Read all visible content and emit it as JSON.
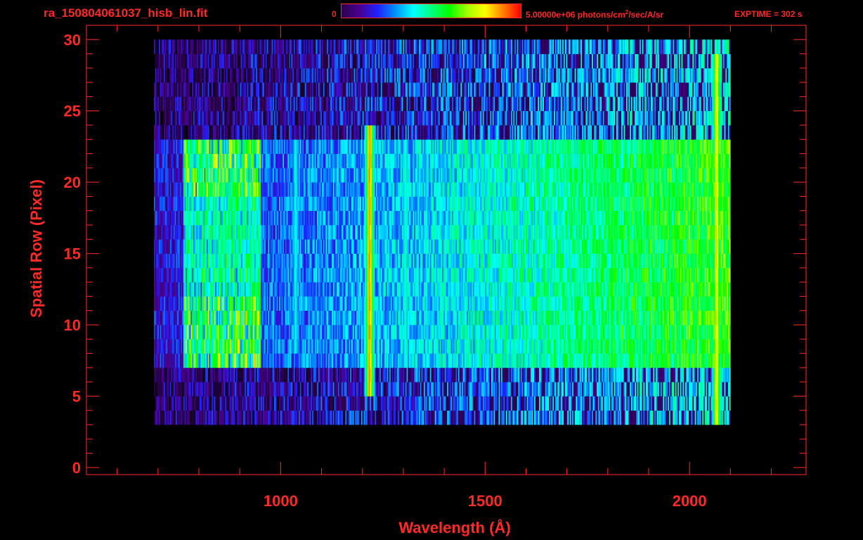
{
  "header": {
    "file_title": "ra_150804061037_hisb_lin.fit",
    "colorbar_min": "0",
    "colorbar_max_prefix": "5.00000e+06 photons/cm",
    "colorbar_max_exp": "2",
    "colorbar_max_suffix": "/sec/A/sr",
    "exptime": "EXPTIME = 302 s"
  },
  "colors": {
    "axis": "#ff2a2a",
    "background": "#000000",
    "colormap": [
      "#000000",
      "#2a0050",
      "#4a0090",
      "#2020ff",
      "#0090ff",
      "#00ffff",
      "#00ff80",
      "#00ff00",
      "#a0ff00",
      "#ffff00",
      "#ff8000",
      "#ff0000"
    ]
  },
  "chart_data": {
    "type": "heatmap",
    "title": "",
    "xlabel": "Wavelength (Å)",
    "ylabel": "Spatial Row (Pixel)",
    "xlim": [
      525,
      2285
    ],
    "ylim": [
      -0.5,
      31
    ],
    "x_ticks": [
      1000,
      1500,
      2000
    ],
    "y_ticks": [
      0,
      5,
      10,
      15,
      20,
      25,
      30
    ],
    "colorbar_range": [
      0,
      5000000
    ],
    "data_extent": {
      "x": [
        690,
        2100
      ],
      "y": [
        3,
        30
      ]
    },
    "dense_band_rows": [
      7,
      23
    ],
    "emission_lines": [
      {
        "x": 1216,
        "level": 0.92,
        "rows": [
          5,
          24
        ]
      },
      {
        "x": 2065,
        "level": 0.85,
        "rows": [
          2,
          29
        ]
      },
      {
        "x": 1304,
        "level": 0.5,
        "rows": [
          7,
          23
        ]
      },
      {
        "x": 1035,
        "level": 0.45,
        "rows": [
          8,
          23
        ]
      },
      {
        "x": 1356,
        "level": 0.42,
        "rows": [
          7,
          23
        ]
      },
      {
        "x": 1480,
        "level": 0.42,
        "rows": [
          7,
          23
        ]
      },
      {
        "x": 1810,
        "level": 0.6,
        "rows": [
          7,
          23
        ]
      }
    ],
    "extended_feature_x": [
      760,
      950
    ],
    "grid": false
  }
}
